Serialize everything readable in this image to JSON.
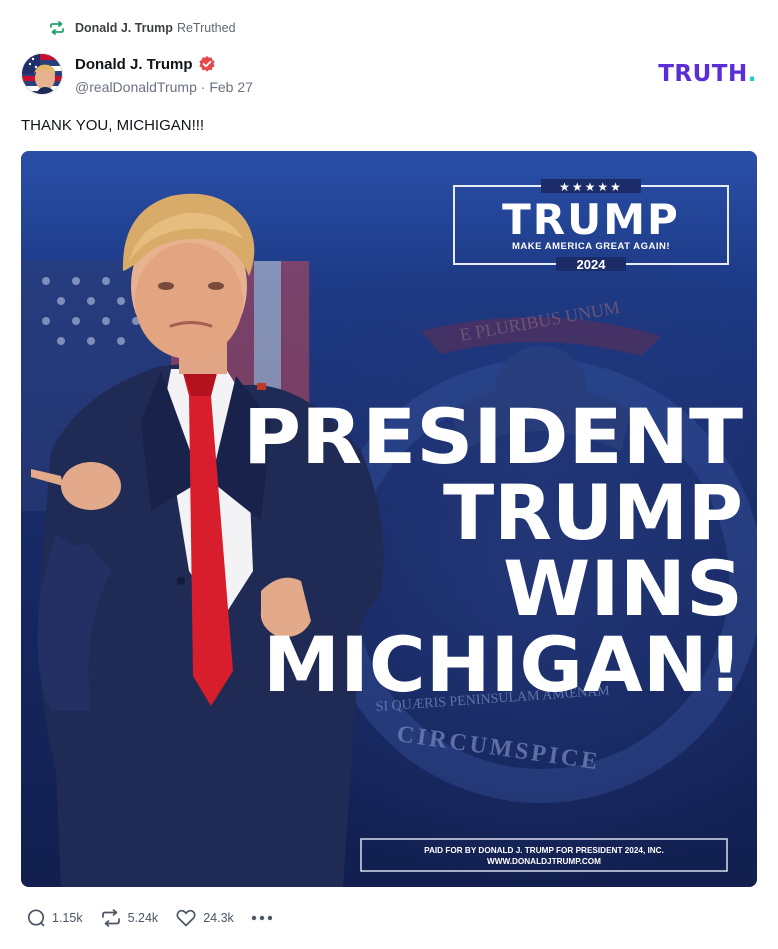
{
  "retruth": {
    "name": "Donald J. Trump",
    "label": "ReTruthed"
  },
  "post": {
    "display_name": "Donald J. Trump",
    "handle": "@realDonaldTrump",
    "separator": "·",
    "date": "Feb 27",
    "text": "THANK YOU, MICHIGAN!!!"
  },
  "brand": {
    "name": "TRUTH",
    "dot": "."
  },
  "media": {
    "stars": "★★★★★",
    "badge_title": "TRUMP",
    "badge_slogan": "MAKE AMERICA GREAT AGAIN!",
    "badge_year": "2024",
    "headline": [
      "PRESIDENT",
      "TRUMP",
      "WINS",
      "MICHIGAN!"
    ],
    "seal_top": "E PLURIBUS UNUM",
    "seal_middle": "SI QUÆRIS PENINSULAM AMŒNAM",
    "seal_bottom": "CIRCUMSPICE",
    "disclaimer_line1": "PAID FOR BY DONALD J. TRUMP FOR PRESIDENT 2024, INC.",
    "disclaimer_line2": "WWW.DONALDJTRUMP.COM"
  },
  "actions": {
    "replies": "1.15k",
    "retruths": "5.24k",
    "likes": "24.3k"
  },
  "colors": {
    "brand_purple": "#5b2fd8",
    "brand_teal": "#16d1c7",
    "verified": "#e5484d",
    "retruth_green": "#22a06b",
    "media_navy": "#16245c",
    "tie_red": "#d81e2c"
  }
}
